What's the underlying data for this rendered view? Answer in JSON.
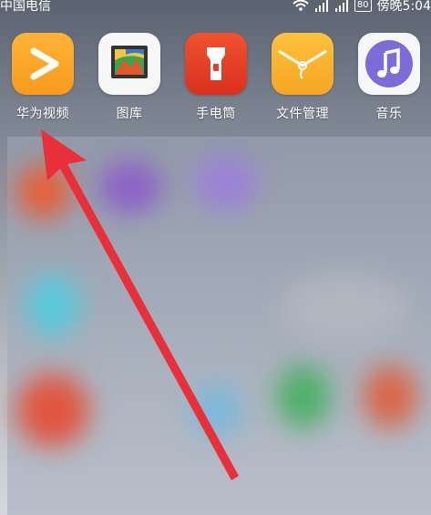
{
  "status_bar": {
    "carrier": "中国电信",
    "battery": "80",
    "time": "傍晚5:04"
  },
  "apps": [
    {
      "label": "华为视频",
      "icon": "play-icon"
    },
    {
      "label": "图库",
      "icon": "gallery-icon"
    },
    {
      "label": "手电筒",
      "icon": "flashlight-icon"
    },
    {
      "label": "文件管理",
      "icon": "folder-icon"
    },
    {
      "label": "音乐",
      "icon": "music-note-icon"
    }
  ],
  "colors": {
    "video": "#f7a21f",
    "torch": "#e0402a",
    "files": "#f7ad2e",
    "music": "#7d6bd8",
    "arrow": "#e8303a"
  }
}
